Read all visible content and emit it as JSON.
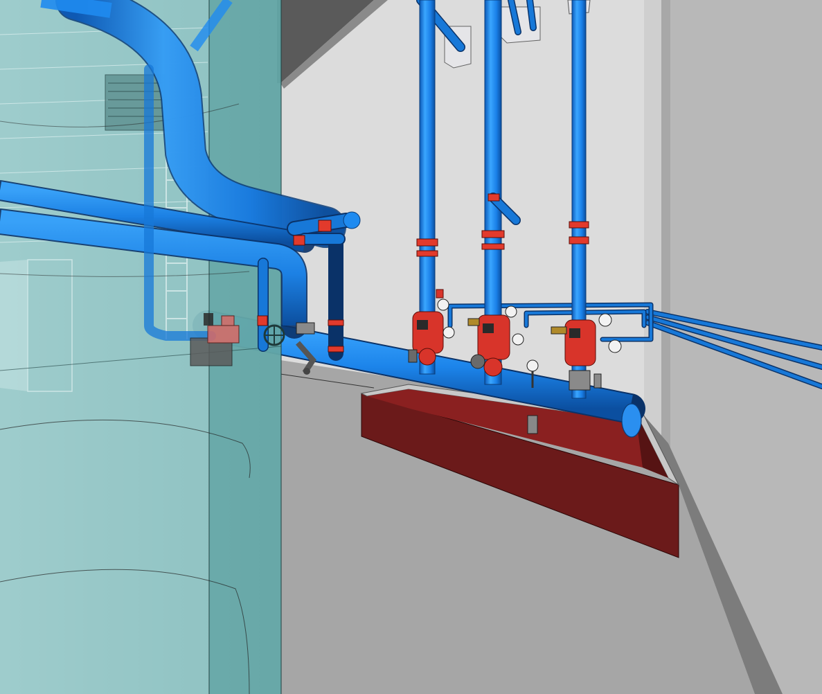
{
  "scene": {
    "label": "",
    "colors": {
      "pipe": "#1f8bf0",
      "pipe_edge": "#0a3c78",
      "valve": "#d8342a",
      "drain_trough": "#6b1a1a",
      "glass_tint": "#3f9a9a",
      "wall": "#dcdcdc",
      "floor": "#a6a6a6",
      "ceiling": "#555555"
    },
    "risers": [
      {
        "name": "riser-1"
      },
      {
        "name": "riser-2"
      },
      {
        "name": "riser-3"
      }
    ]
  }
}
